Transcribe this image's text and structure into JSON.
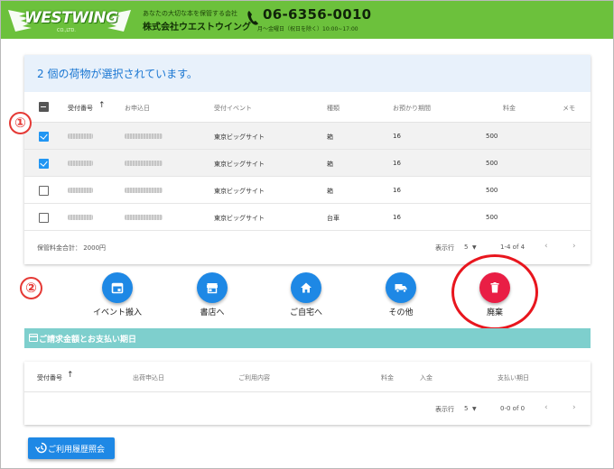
{
  "header": {
    "logo": "WESTWING",
    "logo_sub": "CO.,LTD.",
    "tagline": "あなたの大切な本を保管する会社",
    "company": "株式会社ウエストウイング",
    "phone": "06-6356-0010",
    "hours": "月～金曜日（祝日を除く）10:00~17:00"
  },
  "selection": {
    "text": "2 個の荷物が選択されています。"
  },
  "table1": {
    "columns": {
      "receipt_no": "受付番号",
      "sort_icon": "↑",
      "applied_date": "お申込日",
      "event": "受付イベント",
      "type": "種類",
      "period": "お預かり期間",
      "fee": "料金",
      "memo": "メモ"
    },
    "rows": [
      {
        "event": "東京ビッグサイト",
        "type": "箱",
        "period": "16",
        "fee": "500",
        "checked": true
      },
      {
        "event": "東京ビッグサイト",
        "type": "箱",
        "period": "16",
        "fee": "500",
        "checked": true
      },
      {
        "event": "東京ビッグサイト",
        "type": "箱",
        "period": "16",
        "fee": "500",
        "checked": false
      },
      {
        "event": "東京ビッグサイト",
        "type": "台車",
        "period": "16",
        "fee": "500",
        "checked": false
      }
    ],
    "footer": {
      "total": "保管料金合計：  2000円",
      "rows_per_page_label": "表示行",
      "rows_per_page": "5",
      "range": "1-4 of 4"
    }
  },
  "badges": {
    "one": "①",
    "two": "②"
  },
  "actions": [
    {
      "label": "イベント搬入",
      "icon": "calendar-icon"
    },
    {
      "label": "書店へ",
      "icon": "store-icon"
    },
    {
      "label": "ご自宅へ",
      "icon": "home-icon"
    },
    {
      "label": "その他",
      "icon": "truck-icon"
    },
    {
      "label": "廃棄",
      "icon": "trash-icon"
    }
  ],
  "billing": {
    "title": "ご請求金額とお支払い期日",
    "columns": {
      "receipt_no": "受付番号",
      "sort_icon": "↑",
      "ship_date": "出荷申込日",
      "usage": "ご利用内容",
      "fee": "料金",
      "deposit": "入金",
      "due": "支払い期日"
    },
    "footer": {
      "rows_per_page_label": "表示行",
      "rows_per_page": "5",
      "range": "0-0 of 0"
    }
  },
  "history_button": {
    "label": "ご利用履歴照会"
  },
  "colors": {
    "header_green": "#6cc13c",
    "primary_blue": "#1e88e5",
    "discard_red": "#e91e45",
    "band_teal": "#7ecfcd",
    "highlight_red": "#e8161e"
  }
}
